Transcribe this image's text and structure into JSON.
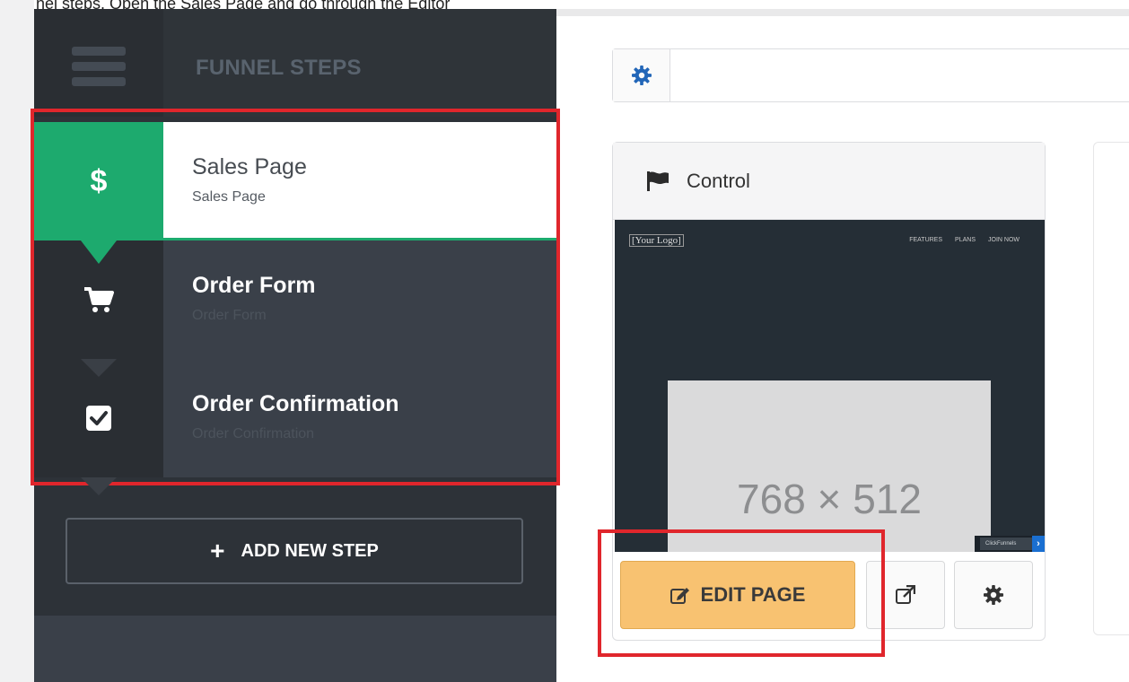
{
  "caption_fragment": "nel steps. Open the Sales Page and go through the Editor",
  "sidebar": {
    "title": "FUNNEL STEPS",
    "steps": [
      {
        "name": "Sales Page",
        "subtitle": "Sales Page",
        "icon": "dollar-icon",
        "icon_text": "$",
        "active": true
      },
      {
        "name": "Order Form",
        "subtitle": "Order Form",
        "icon": "cart-icon",
        "active": false
      },
      {
        "name": "Order Confirmation",
        "subtitle": "Order Confirmation",
        "icon": "checkbox-icon",
        "active": false
      }
    ],
    "add_step_plus": "+",
    "add_step_label": "ADD NEW STEP"
  },
  "variant_card": {
    "label": "Control",
    "flag_icon": "flag-icon",
    "preview": {
      "logo_text": "[Your Logo]",
      "nav": [
        "FEATURES",
        "PLANS",
        "JOIN NOW"
      ],
      "placeholder_text": "768 × 512",
      "badge_text": "ClickFunnels",
      "badge_arrow": "›"
    },
    "edit_button_label": "EDIT PAGE",
    "edit_icon": "edit-icon",
    "external_icon": "external-link-icon",
    "settings_icon": "gear-icon"
  },
  "colors": {
    "accent_green": "#1daa6e",
    "sidebar_bg": "#2d3238",
    "edit_button": "#f8c271",
    "highlight_red": "#e0262c",
    "gear_blue": "#2266b8"
  }
}
